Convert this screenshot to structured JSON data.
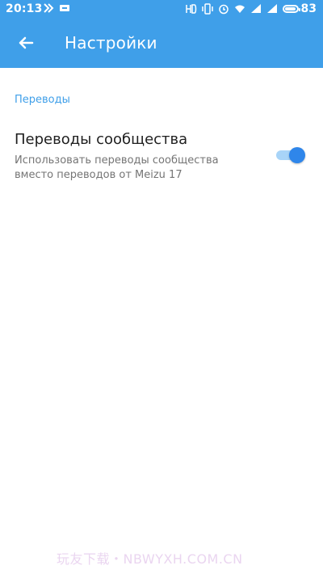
{
  "colors": {
    "accent": "#3f9fe9",
    "toggle_on": "#2f86ea",
    "toggle_track": "#a8d4f8"
  },
  "status_bar": {
    "time": "20:13",
    "battery": "83",
    "icons": [
      "double-chevron-icon",
      "notification-icon",
      "hd-icon",
      "vibrate-icon",
      "alarm-icon",
      "wifi-icon",
      "signal-icon",
      "signal-icon",
      "battery-icon"
    ]
  },
  "header": {
    "title": "Настройки",
    "back_icon": "arrow-left-icon"
  },
  "section": {
    "title": "Переводы"
  },
  "setting": {
    "title": "Переводы сообщества",
    "description": "Использовать переводы сообщества вместо переводов от Meizu 17",
    "enabled": true
  },
  "watermark": "玩友下载・NBWYXH.COM.CN"
}
